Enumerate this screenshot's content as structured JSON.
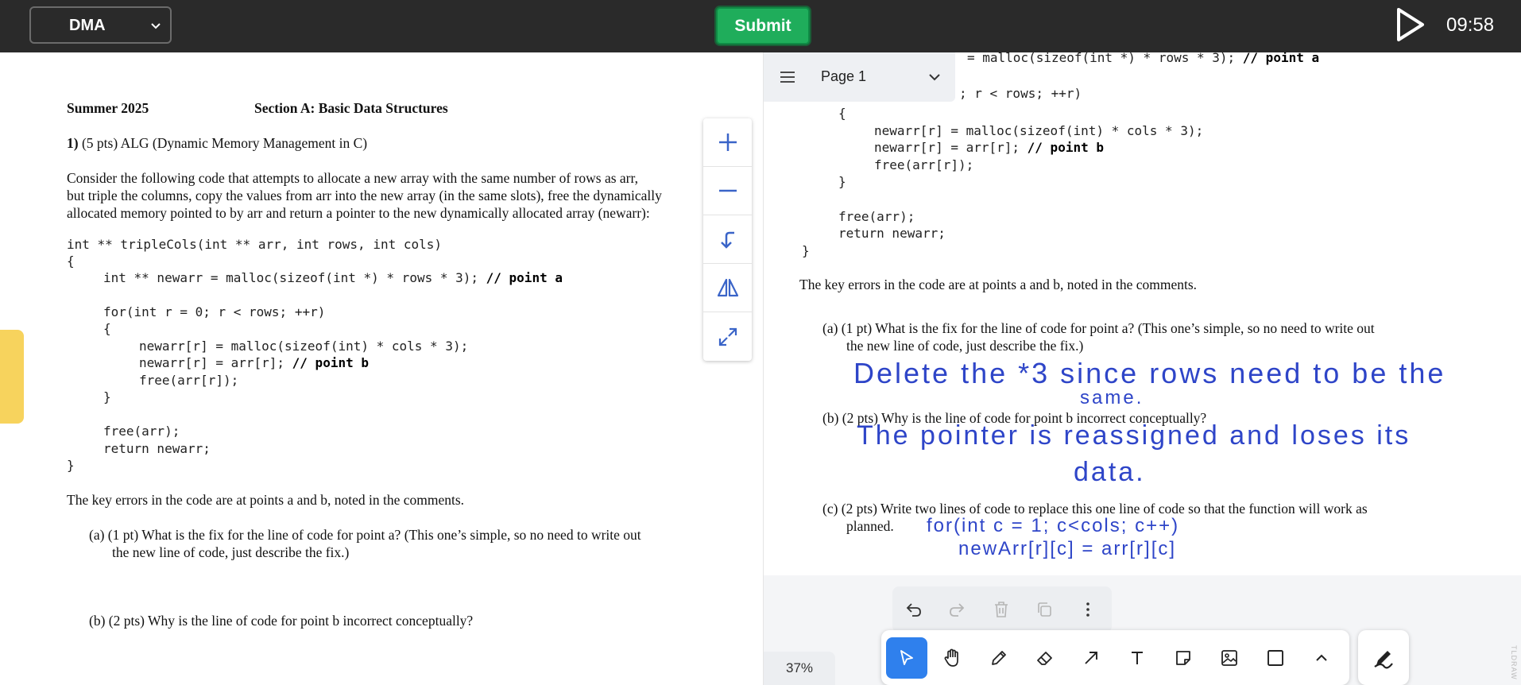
{
  "topbar": {
    "course": "DMA",
    "submit_label": "Submit",
    "timer": "09:58"
  },
  "exam": {
    "term": "Summer 2025",
    "section": "Section A: Basic Data Structures",
    "q_num": "1)",
    "q_title": " (5 pts) ALG (Dynamic Memory Management in C)",
    "intro_lines": [
      "Consider the following code that attempts to allocate a new array with the same number of rows as arr,",
      "but triple the columns, copy the values from arr into the new array (in the same slots), free the dynamically",
      "allocated memory pointed to by arr and return a pointer to the new dynamically allocated array (newarr):"
    ],
    "code": {
      "sig": "int ** tripleCols(int ** arr, int rows, int cols)",
      "open": "{",
      "alloc": "int ** newarr = malloc(sizeof(int *) * rows * 3); ",
      "alloc_comment": "// point a",
      "for_line": "for(int r = 0; r < rows; ++r)",
      "for_open": "{",
      "inner1": "newarr[r] = malloc(sizeof(int) * cols * 3);",
      "inner2": "newarr[r] = arr[r]; ",
      "inner2_comment": "// point b",
      "inner3": "free(arr[r]);",
      "for_close": "}",
      "free_line": "free(arr);",
      "return_line": "return newarr;",
      "close": "}"
    },
    "key_errors": "The key errors in the code are at points a and b, noted in the comments.",
    "qa_line1": "(a)  (1 pt) What is the fix for the line of code for point a? (This one’s simple, so no need to write out",
    "qa_line2": "the new line of code, just describe the fix.)",
    "qb": "(b)  (2 pts) Why is the line of code for point b incorrect conceptually?",
    "qc_line1": "(c)  (2 pts) Write two lines of code to replace this one line of code so that the function will work as",
    "qc_line2": "planned."
  },
  "whiteboard": {
    "page_label": "Page 1",
    "partial_alloc": "= malloc(sizeof(int *) * rows * 3); ",
    "partial_for": "; r < rows; ++r)",
    "zoom": "37%",
    "brand": "TLDRAW",
    "handwriting": {
      "a_line1": "Delete the *3 since rows need to be the",
      "a_line2": "same.",
      "b_line1": "The pointer is reassigned and loses its",
      "b_line2": "data.",
      "c_line1": "for(int c = 1; c<cols; c++)",
      "c_line2": "newArr[r][c] = arr[r][c]"
    }
  },
  "icons": {
    "course_select": "chevron-down-icon",
    "timer_play": "play-icon",
    "strip": [
      "plus-icon",
      "minus-icon",
      "return-arrow-icon",
      "flip-icon",
      "expand-icon"
    ],
    "page_menu": "hamburger-icon",
    "edit": [
      "undo-icon",
      "redo-icon",
      "trash-icon",
      "duplicate-icon",
      "more-vertical-icon"
    ],
    "tools": [
      "select-pointer-icon",
      "hand-icon",
      "pencil-icon",
      "eraser-icon",
      "arrow-icon",
      "text-icon",
      "sticky-note-icon",
      "image-icon",
      "rectangle-icon",
      "chevron-up-icon"
    ],
    "pen": "highlighter-pen-icon"
  },
  "colors": {
    "topbar": "#2a2a2a",
    "submit": "#1fad5b",
    "accent": "#2f80ed",
    "handwriting": "#2e45c8",
    "tab": "#f7d35d",
    "icon_blue": "#3a64c8"
  }
}
